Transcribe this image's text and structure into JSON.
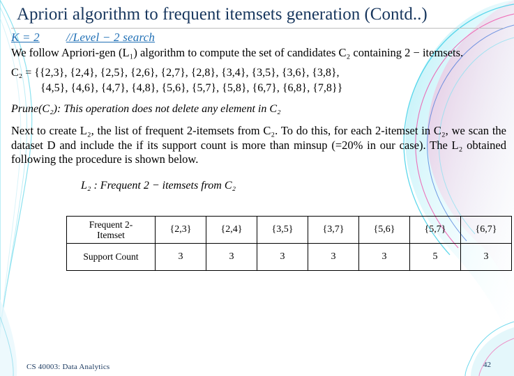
{
  "slide": {
    "title": "Apriori algorithm to frequent itemsets generation (Contd..)",
    "k_line_prefix": "K = 2",
    "k_line_comment": "//Level − 2  search",
    "intro": "We follow Apriori-gen (L₁) algorithm to compute the set of candidates  C₂  containing  2 − itemsets.",
    "c2_line1": "C₂ = {{2,3}, {2,4}, {2,5}, {2,6}, {2,7}, {2,8}, {3,4}, {3,5}, {3,6}, {3,8},",
    "c2_line2": "{4,5}, {4,6}, {4,7}, {4,8}, {5,6}, {5,7}, {5,8}, {6,7}, {6,8}, {7,8}}",
    "prune": "Prune(C₂): This operation does not delete any element  in  C₂",
    "paragraph": "Next to create  L₂, the list of frequent 2-itemsets from  C₂. To do this, for each 2-itemset in  C₂, we scan the dataset D and include the if its support count  is more than minsup (=20% in our case). The  L₂  obtained following the procedure is shown below.",
    "table_caption": "L₂ : Frequent 2 − itemsets from C₂"
  },
  "table": {
    "row_labels": [
      "Frequent 2-Itemset",
      "Support Count"
    ],
    "row_label_line1": "Frequent 2-",
    "row_label_line2": "Itemset",
    "itemsets": [
      "{2,3}",
      "{2,4}",
      "{3,5}",
      "{3,7}",
      "{5,6}",
      "{5,7}",
      "{6,7}"
    ],
    "support_counts": [
      "3",
      "3",
      "3",
      "3",
      "3",
      "5",
      "3"
    ]
  },
  "footer": {
    "course": "CS 40003: Data Analytics",
    "page_number": "42"
  },
  "colors": {
    "title": "#17365d",
    "k_line": "#1f6fb5",
    "footer": "#17365d",
    "swoosh_cyan": "#3fd0e8",
    "swoosh_magenta": "#ef4fa8",
    "swoosh_blue": "#3a6fd8"
  }
}
